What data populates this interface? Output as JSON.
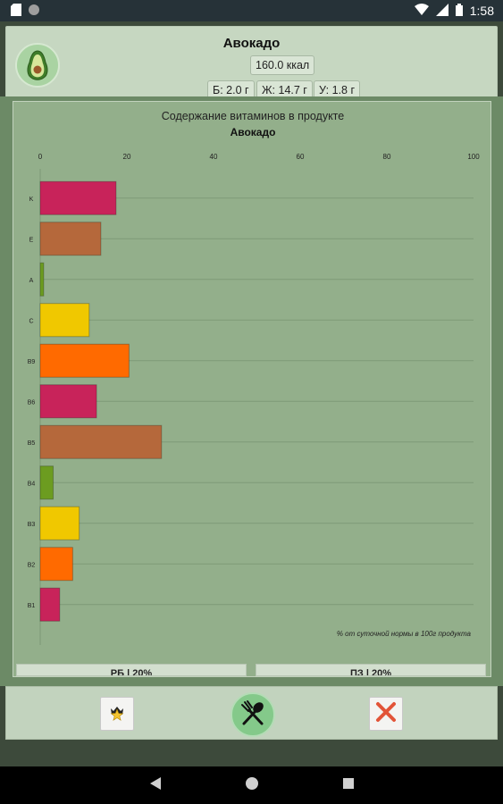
{
  "status_bar": {
    "time": "1:58",
    "icons": [
      "sd-card-icon",
      "circle-icon",
      "wifi-icon",
      "signal-icon",
      "battery-icon"
    ]
  },
  "header": {
    "title": "Авокадо",
    "calories": "160.0 ккал",
    "protein": "Б: 2.0 г",
    "fat": "Ж: 14.7 г",
    "carbs": "У: 1.8 г"
  },
  "chart_data": {
    "type": "bar",
    "orientation": "horizontal",
    "title": "Содержание витаминов в продукте",
    "subtitle": "Авокадо",
    "categories": [
      "K",
      "E",
      "A",
      "C",
      "B9",
      "B6",
      "B5",
      "B4",
      "B3",
      "B2",
      "B1"
    ],
    "values": [
      17.5,
      14.0,
      0.8,
      11.3,
      20.5,
      13.0,
      28.0,
      3.0,
      9.0,
      7.5,
      4.5
    ],
    "colors": [
      "#c8235a",
      "#b5683b",
      "#6c9c20",
      "#f0c800",
      "#ff6a00",
      "#c8235a",
      "#b5683b",
      "#6c9c20",
      "#f0c800",
      "#ff6a00",
      "#c8235a"
    ],
    "xlim": [
      0,
      100
    ],
    "xticks": [
      "0",
      "20",
      "40",
      "60",
      "80",
      "100"
    ],
    "note": "% от суточной нормы в 100г продукта",
    "grid": true
  },
  "bottom_cards": [
    "РБ | 20%",
    "ПЗ | 20%"
  ]
}
